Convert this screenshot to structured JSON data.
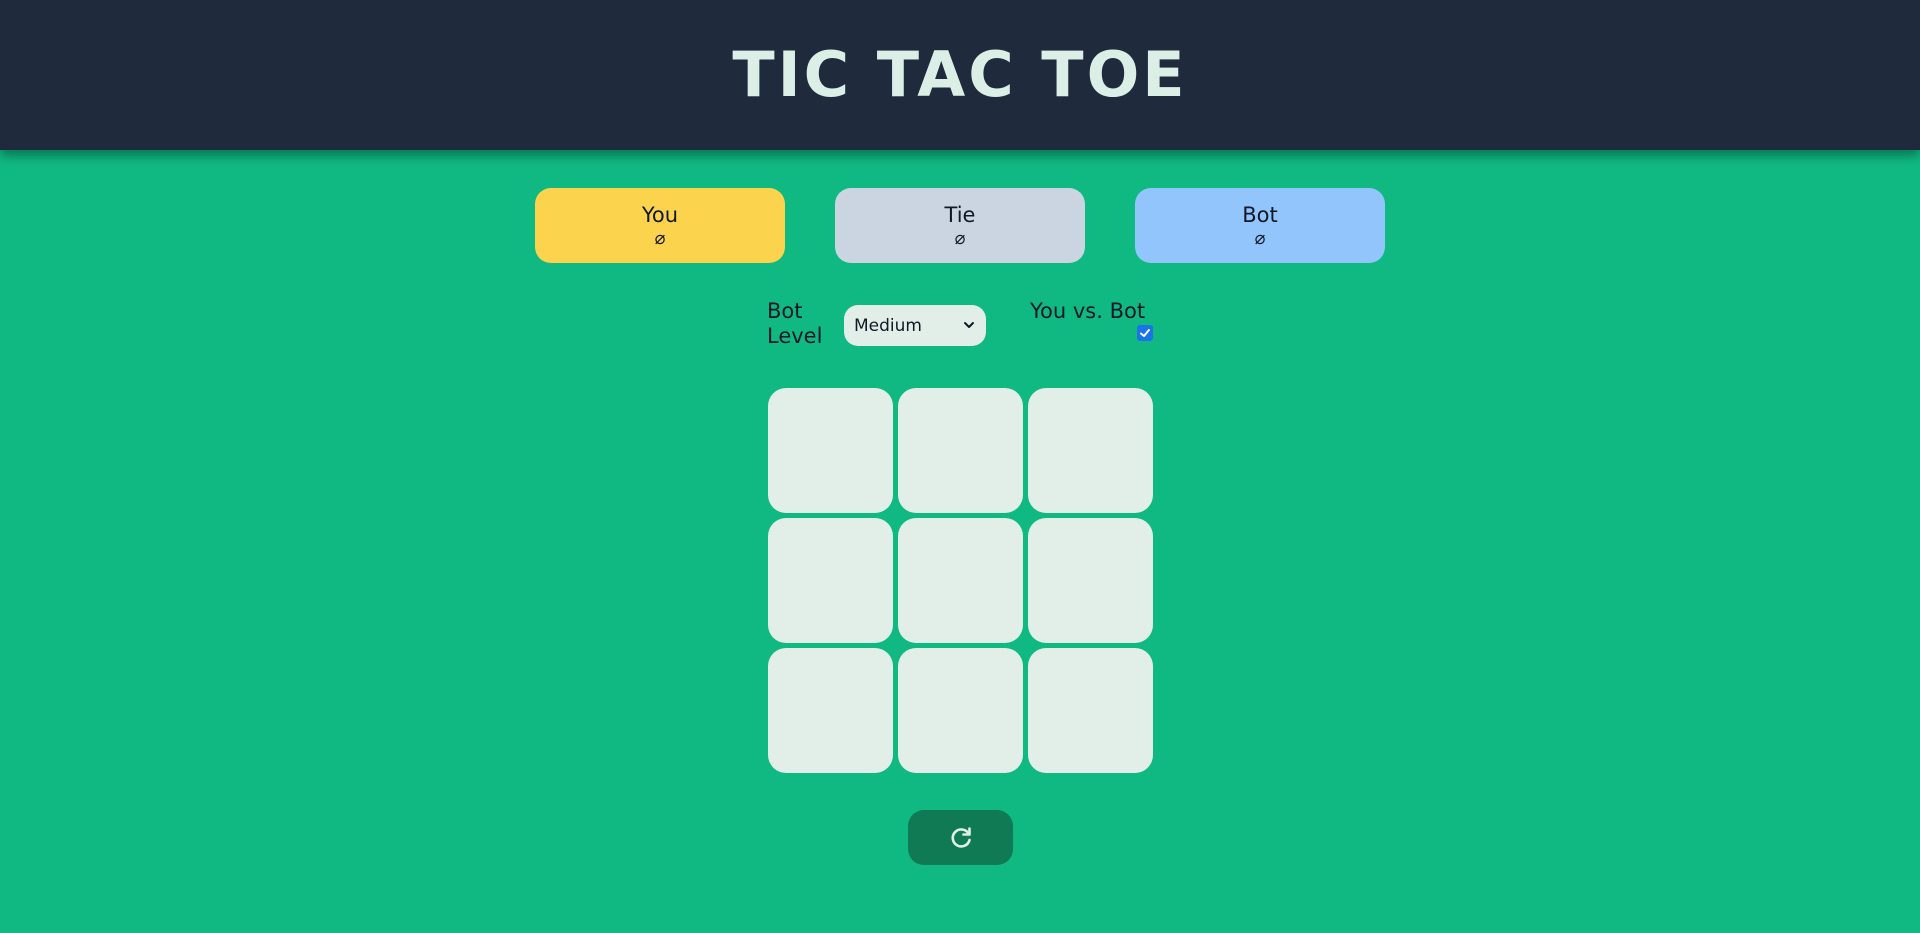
{
  "header": {
    "title": "TIC TAC TOE"
  },
  "scores": {
    "you": {
      "label": "You",
      "value": "⌀"
    },
    "tie": {
      "label": "Tie",
      "value": "⌀"
    },
    "bot": {
      "label": "Bot",
      "value": "⌀"
    }
  },
  "controls": {
    "bot_level_label": "Bot Level",
    "bot_level_selected": "Medium",
    "vs_label": "You vs. Bot",
    "vs_checked": true
  },
  "board": {
    "cells": [
      "",
      "",
      "",
      "",
      "",
      "",
      "",
      "",
      ""
    ]
  },
  "reset": {
    "icon": "refresh-icon"
  },
  "colors": {
    "background": "#10b981",
    "header": "#1f2a3d",
    "you": "#fcd34d",
    "tie": "#cbd5e1",
    "bot": "#93c5fd",
    "cell": "#e1efe8",
    "reset": "#0f7a54"
  }
}
